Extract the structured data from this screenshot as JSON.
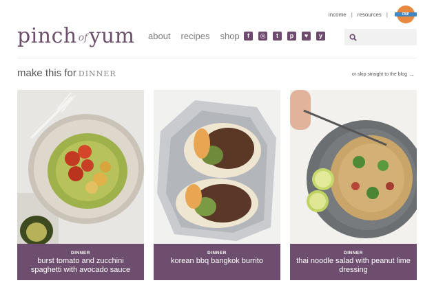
{
  "utility": {
    "links": [
      "income",
      "resources"
    ],
    "badge_text": "FOOD Blogger PRO"
  },
  "logo": {
    "part1": "pinch",
    "part2": "of",
    "part3": "yum"
  },
  "nav": [
    "about",
    "recipes",
    "shop"
  ],
  "social": [
    {
      "icon": "facebook-icon",
      "glyph": "f"
    },
    {
      "icon": "instagram-icon",
      "glyph": "◎"
    },
    {
      "icon": "twitter-icon",
      "glyph": "t"
    },
    {
      "icon": "pinterest-icon",
      "glyph": "p"
    },
    {
      "icon": "heart-icon",
      "glyph": "♥"
    },
    {
      "icon": "yummly-icon",
      "glyph": "y"
    }
  ],
  "search": {
    "placeholder": ""
  },
  "section": {
    "heading": "make this for",
    "keyword": "DINNER",
    "skip_link": "or skip straight to the blog",
    "skip_arrow": "→"
  },
  "cards": [
    {
      "category": "DINNER",
      "title": "burst tomato and zucchini spaghetti with avocado sauce"
    },
    {
      "category": "DINNER",
      "title": "korean bbq bangkok burrito"
    },
    {
      "category": "DINNER",
      "title": "thai noodle salad with peanut lime dressing"
    }
  ],
  "colors": {
    "brand_purple": "#6e4e6e",
    "text_gray": "#7b7b7b"
  }
}
